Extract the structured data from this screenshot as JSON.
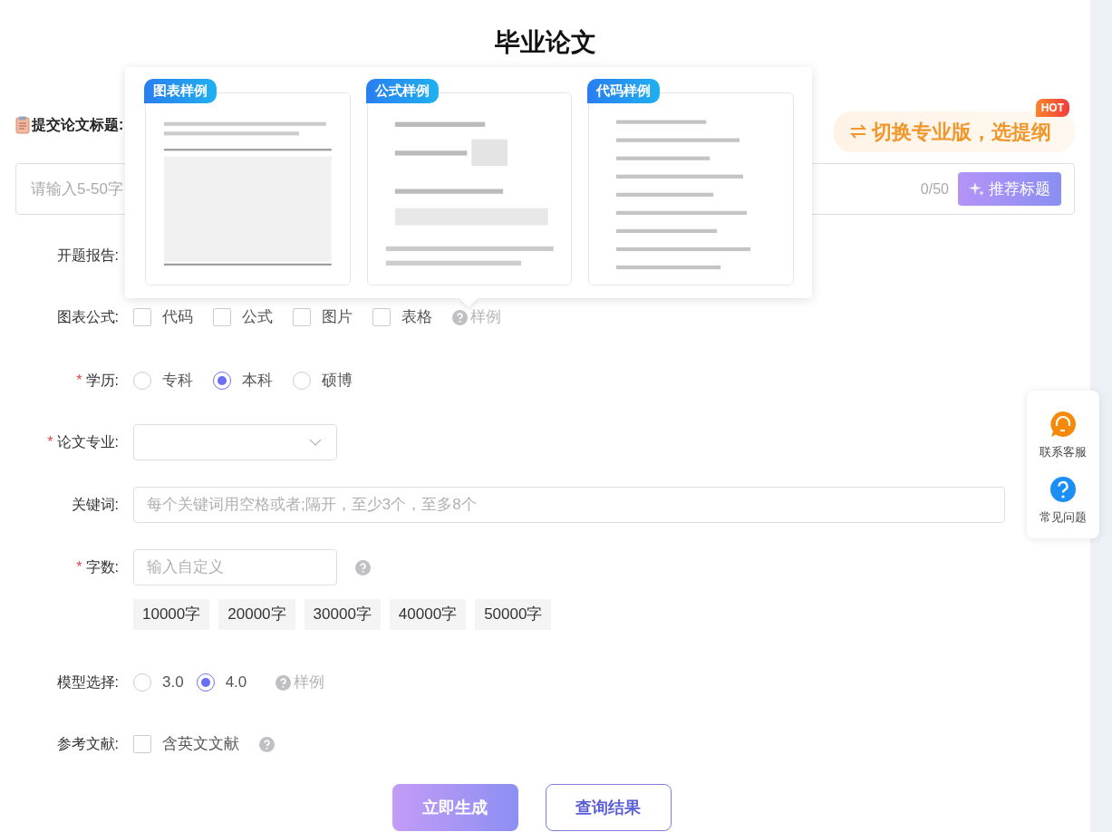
{
  "page_title": "毕业论文",
  "title_field": {
    "label": "提交论文标题:",
    "placeholder": "请输入5-50字",
    "counter": "0/50",
    "button": "推荐标题"
  },
  "pro_banner": {
    "text": "切换专业版，选提纲",
    "badge": "HOT"
  },
  "opening_report": {
    "label": "开题报告:"
  },
  "samples_popover": {
    "cards": [
      {
        "label": "图表样例",
        "kind": "picture"
      },
      {
        "label": "公式样例",
        "kind": "picture"
      },
      {
        "label": "代码样例",
        "kind": "picture"
      }
    ]
  },
  "charts_formulas": {
    "label": "图表公式:",
    "options": [
      {
        "label": "代码",
        "checked": false
      },
      {
        "label": "公式",
        "checked": false
      },
      {
        "label": "图片",
        "checked": false
      },
      {
        "label": "表格",
        "checked": false
      }
    ],
    "sample_link": "样例"
  },
  "education": {
    "label": "学历:",
    "required_mark": "*",
    "options": [
      {
        "label": "专科",
        "selected": false
      },
      {
        "label": "本科",
        "selected": true
      },
      {
        "label": "硕博",
        "selected": false
      }
    ]
  },
  "major": {
    "label": "论文专业:",
    "required_mark": "*"
  },
  "keywords": {
    "label": "关键词:",
    "placeholder": "每个关键词用空格或者;隔开，至少3个，至多8个"
  },
  "word_count": {
    "label": "字数:",
    "required_mark": "*",
    "placeholder": "输入自定义",
    "presets": [
      "10000字",
      "20000字",
      "30000字",
      "40000字",
      "50000字"
    ]
  },
  "model": {
    "label": "模型选择:",
    "options": [
      {
        "label": "3.0",
        "selected": false
      },
      {
        "label": "4.0",
        "selected": true
      }
    ],
    "sample_link": "样例"
  },
  "references": {
    "label": "参考文献:",
    "options": [
      {
        "label": "含英文文献",
        "checked": false
      }
    ]
  },
  "actions": [
    "立即生成",
    "查询结果"
  ],
  "float_panel": [
    {
      "label": "联系客服",
      "kind": "service"
    },
    {
      "label": "常见问题",
      "kind": "faq"
    }
  ]
}
